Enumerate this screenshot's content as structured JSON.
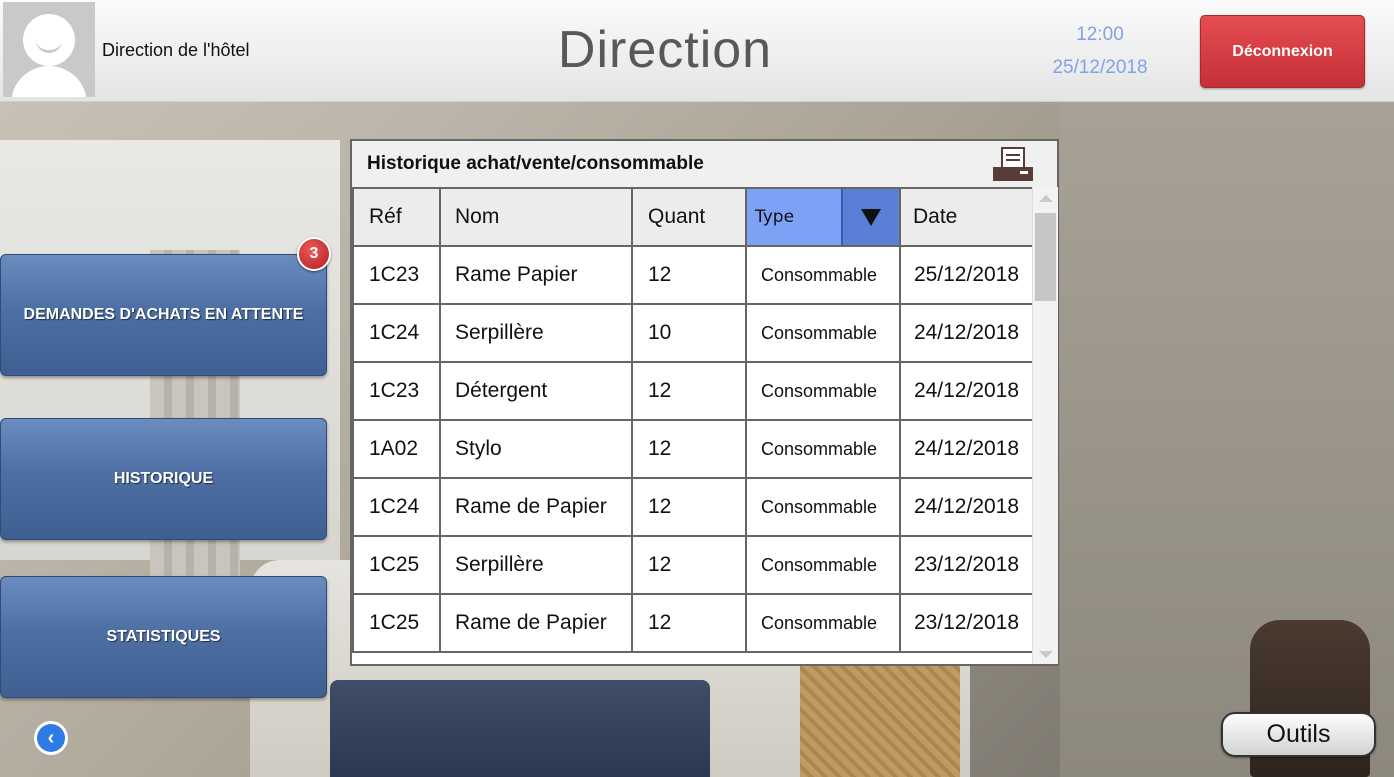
{
  "header": {
    "hotel_name": "Direction de l'hôtel",
    "title": "Direction",
    "time": "12:00",
    "date": "25/12/2018",
    "logout_label": "Déconnexion"
  },
  "sidebar": {
    "items": [
      {
        "label": "DEMANDES D'ACHATS EN ATTENTE",
        "badge": "3"
      },
      {
        "label": "HISTORIQUE"
      },
      {
        "label": "STATISTIQUES"
      }
    ]
  },
  "panel": {
    "title": "Historique achat/vente/consommable",
    "columns": {
      "ref": "Réf",
      "nom": "Nom",
      "quant": "Quant",
      "type": "Type",
      "date": "Date"
    },
    "rows": [
      {
        "ref": "1C23",
        "nom": "Rame Papier",
        "quant": "12",
        "type": "Consommable",
        "date": "25/12/2018"
      },
      {
        "ref": "1C24",
        "nom": "Serpillère",
        "quant": "10",
        "type": "Consommable",
        "date": "24/12/2018"
      },
      {
        "ref": "1C23",
        "nom": "Détergent",
        "quant": "12",
        "type": "Consommable",
        "date": "24/12/2018"
      },
      {
        "ref": "1A02",
        "nom": "Stylo",
        "quant": "12",
        "type": "Consommable",
        "date": "24/12/2018"
      },
      {
        "ref": "1C24",
        "nom": "Rame de Papier",
        "quant": "12",
        "type": "Consommable",
        "date": "24/12/2018"
      },
      {
        "ref": "1C25",
        "nom": "Serpillère",
        "quant": "12",
        "type": "Consommable",
        "date": "23/12/2018"
      },
      {
        "ref": "1C25",
        "nom": "Rame de Papier",
        "quant": "12",
        "type": "Consommable",
        "date": "23/12/2018"
      }
    ]
  },
  "footer": {
    "tools_label": "Outils"
  },
  "colors": {
    "accent_blue": "#4d6fa3",
    "logout_red": "#d9393f",
    "type_header": "#7da2f5",
    "clock": "#7fa3e6"
  },
  "icons": {
    "print": "printer-icon",
    "back": "back-arrow-icon",
    "dropdown": "dropdown-triangle-icon"
  }
}
